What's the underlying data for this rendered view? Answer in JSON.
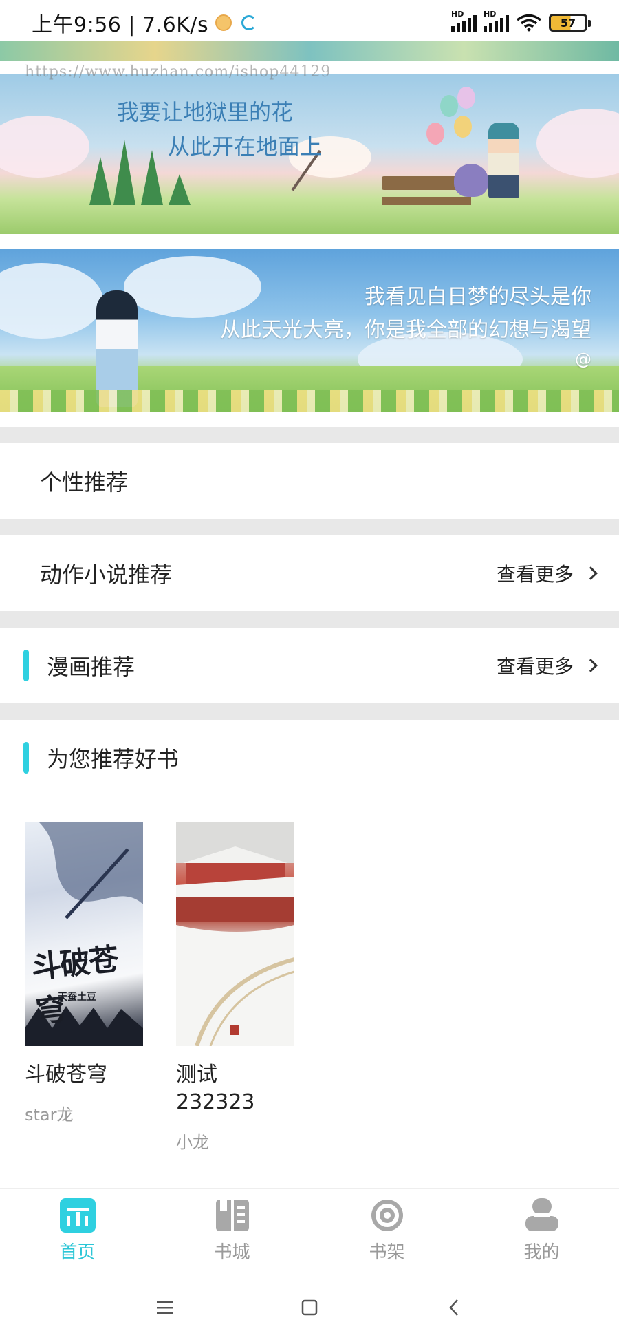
{
  "status_bar": {
    "time_speed": "上午9:56 | 7.6K/s",
    "signal_1_label": "HD",
    "signal_2_label": "HD",
    "battery_level": "57"
  },
  "watermark": "https://www.huzhan.com/ishop44129",
  "banners": [
    {
      "line1": "我要让地狱里的花",
      "line2": "从此开在地面上"
    },
    {
      "line1": "我看见白日梦的尽头是你",
      "line2": "从此天光大亮，你是我全部的幻想与渴望",
      "mark": "@"
    }
  ],
  "sections": {
    "personal": {
      "title": "个性推荐"
    },
    "action_novels": {
      "title": "动作小说推荐",
      "more": "查看更多"
    },
    "comics": {
      "title": "漫画推荐",
      "more": "查看更多"
    },
    "recommend_books": {
      "title": "为您推荐好书"
    }
  },
  "books": [
    {
      "title": "斗破苍穹",
      "author": "star龙",
      "cover_text": "斗破苍穹",
      "cover_sub": "天蚕土豆"
    },
    {
      "title": "测试232323",
      "title_line1": "测试",
      "title_line2": "232323",
      "author": "小龙"
    }
  ],
  "bottom_nav": [
    {
      "label": "首页",
      "icon": "home-icon",
      "active": true
    },
    {
      "label": "书城",
      "icon": "book-store-icon",
      "active": false
    },
    {
      "label": "书架",
      "icon": "bookshelf-icon",
      "active": false
    },
    {
      "label": "我的",
      "icon": "profile-icon",
      "active": false
    }
  ],
  "colors": {
    "accent": "#2fd0e0",
    "inactive": "#9a9a9a",
    "divider": "#e8e8e8"
  }
}
